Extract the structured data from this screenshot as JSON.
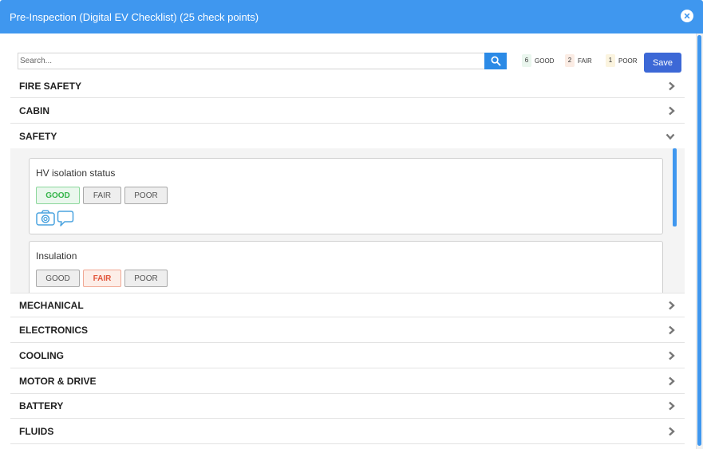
{
  "window": {
    "title": "Pre-Inspection (Digital EV Checklist) (25 check points)"
  },
  "search": {
    "placeholder": "Search..."
  },
  "legend": {
    "good": {
      "count": "6",
      "label": "GOOD"
    },
    "fair": {
      "count": "2",
      "label": "FAIR"
    },
    "poor": {
      "count": "1",
      "label": "POOR"
    }
  },
  "save_label": "Save",
  "sections": {
    "fire_safety": "FIRE SAFETY",
    "cabin": "CABIN",
    "safety": "SAFETY",
    "mechanical": "MECHANICAL",
    "electronics": "ELECTRONICS",
    "cooling": "COOLING",
    "motor_drive": "MOTOR & DRIVE",
    "battery": "BATTERY",
    "fluids": "FLUIDS"
  },
  "safety_items": [
    {
      "title": "HV isolation status",
      "options": [
        "GOOD",
        "FAIR",
        "POOR"
      ],
      "selected": "GOOD"
    },
    {
      "title": "Insulation",
      "options": [
        "GOOD",
        "FAIR",
        "POOR"
      ],
      "selected": "FAIR"
    }
  ],
  "icons": {
    "close": "close-icon",
    "search": "search-icon",
    "collapsed": "chevron-right-icon",
    "expanded": "chevron-down-icon",
    "camera": "camera-icon",
    "comment": "comment-icon"
  },
  "colors": {
    "header": "#3f97ef",
    "save_button": "#3c68d6",
    "good": "#35b54a",
    "fair": "#e2563c",
    "icon_blue": "#4aa3df"
  }
}
